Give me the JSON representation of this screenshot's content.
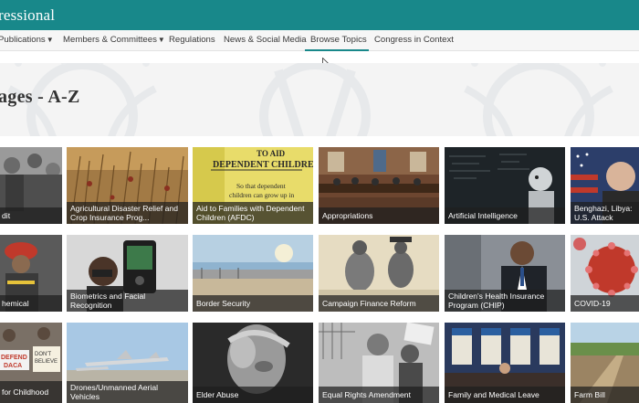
{
  "brand": {
    "text": "ressional"
  },
  "nav": {
    "items": [
      {
        "label": "Publications",
        "caret": "▼"
      },
      {
        "label": "Members & Committees",
        "caret": "▼"
      },
      {
        "label": "Regulations"
      },
      {
        "label": "News & Social Media"
      },
      {
        "label": "Browse Topics",
        "active": true
      },
      {
        "label": "Congress in Context"
      }
    ]
  },
  "hero": {
    "title": "ages - A-Z"
  },
  "topics": [
    {
      "label": "dit"
    },
    {
      "label": "Agricultural Disaster Relief and Crop Insurance Prog..."
    },
    {
      "label": "Aid to Families with Dependent Children (AFDC)",
      "image_text": [
        "TO AID",
        "DEPENDENT CHILDREN",
        "So that dependent",
        "children can grow up in"
      ]
    },
    {
      "label": "Appropriations"
    },
    {
      "label": "Artificial Intelligence"
    },
    {
      "label": "Benghazi, Libya: U.S. Attack"
    },
    {
      "label": "hemical"
    },
    {
      "label": "Biometrics and Facial Recognition"
    },
    {
      "label": "Border Security"
    },
    {
      "label": "Campaign Finance Reform"
    },
    {
      "label": "Children's Health Insurance Program (CHIP)"
    },
    {
      "label": "COVID-19"
    },
    {
      "label": "for Childhood",
      "image_text": [
        "DEFEND",
        "DACA",
        "DON'T",
        "BELIEVE"
      ]
    },
    {
      "label": "Drones/Unmanned Aerial Vehicles"
    },
    {
      "label": "Elder Abuse"
    },
    {
      "label": "Equal Rights Amendment"
    },
    {
      "label": "Family and Medical Leave"
    },
    {
      "label": "Farm Bill"
    }
  ],
  "colors": {
    "brand_teal": "#18888a",
    "caption_bg": "rgba(30,30,30,0.72)"
  }
}
